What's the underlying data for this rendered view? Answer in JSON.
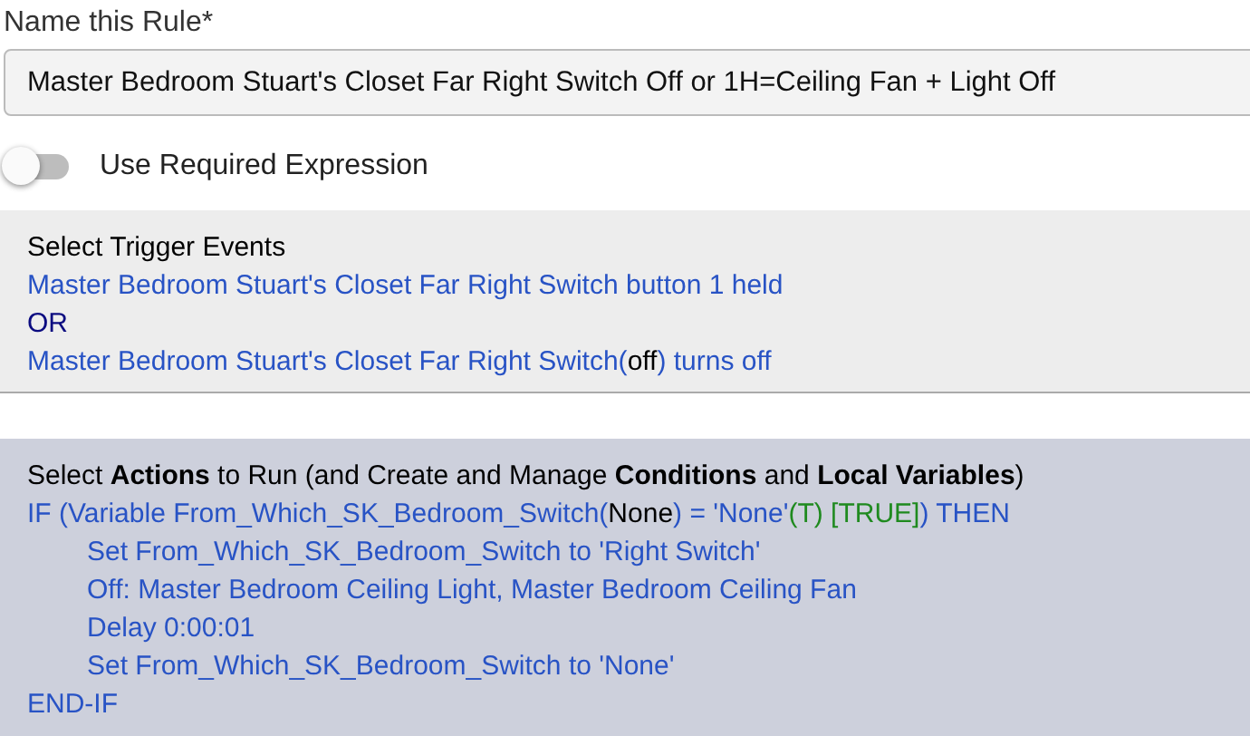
{
  "rule_name": {
    "label": "Name this Rule*",
    "value": "Master Bedroom Stuart's Closet Far Right Switch Off or 1H=Ceiling Fan + Light Off"
  },
  "required_expression": {
    "label": "Use Required Expression",
    "on": false
  },
  "triggers": {
    "title": "Select Trigger Events",
    "lines": [
      [
        {
          "text": "Master Bedroom Stuart's Closet Far Right Switch button 1 held",
          "kind": "link"
        }
      ],
      [
        {
          "text": "OR",
          "kind": "operator"
        }
      ],
      [
        {
          "text": "Master Bedroom Stuart's Closet Far Right Switch(",
          "kind": "link"
        },
        {
          "text": "off",
          "kind": "plain"
        },
        {
          "text": ") turns off",
          "kind": "link"
        }
      ]
    ]
  },
  "actions": {
    "title": "Select **Actions** to Run (and Create and Manage **Conditions** and **Local Variables**)",
    "lines": [
      {
        "segments": [
          {
            "text": "IF (Variable From_Which_SK_Bedroom_Switch(",
            "kind": "link"
          },
          {
            "text": "None",
            "kind": "plain"
          },
          {
            "text": ") = 'None'",
            "kind": "link"
          },
          {
            "text": "(T) [TRUE]",
            "kind": "green"
          },
          {
            "text": ") THEN",
            "kind": "link"
          }
        ],
        "children": [
          {
            "segments": [
              {
                "text": "Set From_Which_SK_Bedroom_Switch to 'Right Switch'",
                "kind": "link"
              }
            ]
          },
          {
            "segments": [
              {
                "text": "Off: Master Bedroom Ceiling Light, Master Bedroom Ceiling Fan",
                "kind": "link"
              }
            ]
          },
          {
            "segments": [
              {
                "text": "Delay 0:00:01",
                "kind": "link"
              }
            ]
          },
          {
            "segments": [
              {
                "text": "Set From_Which_SK_Bedroom_Switch to 'None'",
                "kind": "link"
              }
            ]
          }
        ]
      },
      {
        "segments": [
          {
            "text": "END-IF",
            "kind": "link"
          }
        ]
      }
    ]
  }
}
